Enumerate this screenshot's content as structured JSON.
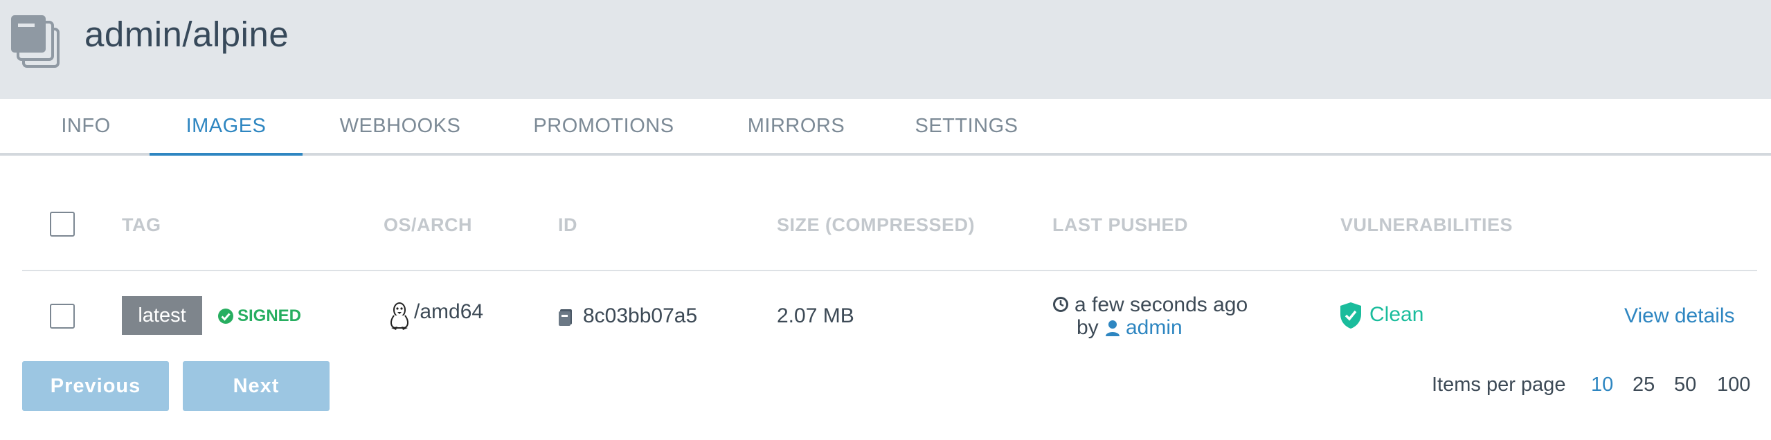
{
  "header": {
    "repo_title": "admin/alpine",
    "icon": "repository-stack-icon"
  },
  "tabs": [
    "INFO",
    "IMAGES",
    "WEBHOOKS",
    "PROMOTIONS",
    "MIRRORS",
    "SETTINGS"
  ],
  "active_tab": "IMAGES",
  "table": {
    "columns": [
      "TAG",
      "OS/ARCH",
      "ID",
      "SIZE (COMPRESSED)",
      "LAST PUSHED",
      "VULNERABILITIES"
    ],
    "rows": [
      {
        "tag": "latest",
        "signed_label": "SIGNED",
        "os_arch": "/amd64",
        "os_icon": "linux-tux-icon",
        "id": "8c03bb07a5",
        "size": "2.07 MB",
        "last_pushed": "a few seconds ago",
        "pushed_by_prefix": "by",
        "pushed_by": "admin",
        "vulnerabilities": "Clean",
        "details_link": "View details"
      }
    ]
  },
  "pagination": {
    "previous_label": "Previous",
    "next_label": "Next",
    "items_per_page_label": "Items per page",
    "options": [
      "10",
      "25",
      "50",
      "100"
    ],
    "selected": "10"
  },
  "colors": {
    "accent": "#2e86c1",
    "signed": "#27ae60",
    "clean": "#1abc9c",
    "header_bg": "#e2e6ea",
    "button_disabled": "#9cc6e2"
  }
}
